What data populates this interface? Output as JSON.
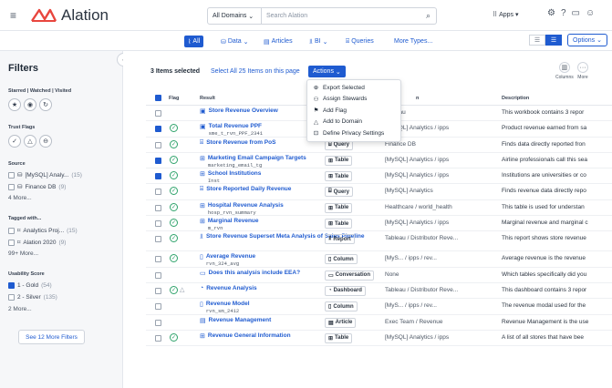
{
  "topbar": {
    "logo_text": "Alation",
    "domain_select": "All Domains",
    "search_placeholder": "Search Alation",
    "apps_label": "Apps"
  },
  "typebar": {
    "tabs": [
      {
        "label": "All",
        "icon": "list-icon",
        "active": true
      },
      {
        "label": "Data",
        "icon": "database-icon",
        "dropdown": true
      },
      {
        "label": "Articles",
        "icon": "article-icon"
      },
      {
        "label": "BI",
        "icon": "bi-icon",
        "dropdown": true
      },
      {
        "label": "Queries",
        "icon": "query-icon"
      },
      {
        "label": "More Types...",
        "icon": ""
      }
    ],
    "options_label": "Options"
  },
  "sidebar": {
    "title": "Filters",
    "starred_label": "Starred | Watched | Visited",
    "trust_label": "Trust Flags",
    "source_label": "Source",
    "source_items": [
      {
        "label": "[MySQL] Analy...",
        "count": "(15)"
      },
      {
        "label": "Finance DB",
        "count": "(9)"
      }
    ],
    "source_more": "4 More...",
    "tagged_label": "Tagged with...",
    "tag_items": [
      {
        "label": "Analytics Proj...",
        "count": "(15)"
      },
      {
        "label": "Alation 2020",
        "count": "(9)"
      }
    ],
    "tag_more": "99+ More...",
    "usability_label": "Usability Score",
    "usability_items": [
      {
        "label": "1 - Gold",
        "count": "(54)",
        "checked": true
      },
      {
        "label": "2 - Silver",
        "count": "(135)",
        "checked": false
      }
    ],
    "usability_more": "2 More...",
    "see_more": "See 12 More Filters"
  },
  "main": {
    "selected_count": "3 Items selected",
    "select_all": "Select All 25 Items on this page",
    "actions_label": "Actions",
    "columns_label": "Columns",
    "more_label": "More",
    "headers": {
      "flag": "Flag",
      "result": "Result",
      "location": "n",
      "description": "Description"
    }
  },
  "actions_menu": [
    {
      "label": "Export Selected",
      "icon": "export-icon"
    },
    {
      "label": "Assign Stewards",
      "icon": "stewards-icon"
    },
    {
      "label": "Add Flag",
      "icon": "flag-icon"
    },
    {
      "label": "Add to Domain",
      "icon": "domain-icon"
    },
    {
      "label": "Define Privacy Settings",
      "icon": "lock-icon"
    }
  ],
  "rows": [
    {
      "checked": false,
      "flag": false,
      "title": "Store Revenue Overview",
      "sub": "",
      "type": "",
      "loc": "Tableau",
      "desc": "This workbook contains 3 repor"
    },
    {
      "checked": true,
      "flag": true,
      "title": "Total Revenue PPF",
      "sub": "sme_t_rvn_PPF_2341",
      "type": "",
      "loc": "[MySQL] Analytics / ipps",
      "desc": "Product revenue earned from sa"
    },
    {
      "checked": false,
      "flag": true,
      "title": "Store Revenue from PoS",
      "sub": "",
      "type": "Query",
      "loc": "Finance DB",
      "desc": "Finds data directly reported fron"
    },
    {
      "checked": true,
      "flag": true,
      "title": "Marketing Email Campaign Targets",
      "sub": "marketing_email_tg",
      "type": "Table",
      "loc": "[MySQL] Analytics / ipps",
      "desc": "Airline professionals call this sea"
    },
    {
      "checked": true,
      "flag": true,
      "title": "School Institutions",
      "sub": "Inst",
      "type": "Table",
      "loc": "[MySQL] Analytics / ipps",
      "desc": "Institutions are universities or co"
    },
    {
      "checked": false,
      "flag": true,
      "title": "Store Reported Daily Revenue",
      "sub": "",
      "type": "Query",
      "loc": "[MySQL] Analytics",
      "desc": "Finds revenue data directly repo"
    },
    {
      "checked": false,
      "flag": true,
      "title": "Hospital Revenue Analysis",
      "sub": "hosp_rvn_summary",
      "type": "Table",
      "loc": "Healthcare / world_health",
      "desc": "This table is used for understan"
    },
    {
      "checked": false,
      "flag": true,
      "title": "Marginal Revenue",
      "sub": "m_rvn",
      "type": "Table",
      "loc": "[MySQL] Analytics / ipps",
      "desc": "Marginal revenue and marginal c"
    },
    {
      "checked": false,
      "flag": true,
      "title": "Store Revenue Superset Meta Analysis of Sales Pipeline",
      "sub": "",
      "type": "Report",
      "loc": "Tableau / Distributor Reve...",
      "desc": "This report shows store revenue"
    },
    {
      "checked": false,
      "flag": true,
      "title": "Average Revenue",
      "sub": "rvn_324_avg",
      "type": "Column",
      "loc": "[MyS... / ipps / rev...",
      "desc": "Average revenue is the revenue"
    },
    {
      "checked": false,
      "flag": false,
      "title": "Does this analysis include EEA?",
      "sub": "",
      "type": "Conversation",
      "loc": "None",
      "desc": "Which tables specifically did you"
    },
    {
      "checked": false,
      "flag": true,
      "title": "Revenue Analysis",
      "sub": "",
      "type": "Dashboard",
      "loc": "Tableau / Distributor Reve...",
      "desc": "This dashboard contains 3 repor"
    },
    {
      "checked": false,
      "flag": false,
      "title": "Revenue Model",
      "sub": "rvn_sm_2412",
      "type": "Column",
      "loc": "[MyS... / ipps / rev...",
      "desc": "The revenue modal used for the"
    },
    {
      "checked": false,
      "flag": false,
      "title": "Revenue Management",
      "sub": "",
      "type": "Article",
      "loc": "Exec Team / Revenue",
      "desc": "Revenue Management is the use"
    },
    {
      "checked": false,
      "flag": true,
      "title": "Revenue General Information",
      "sub": "",
      "type": "Table",
      "loc": "[MySQL] Analytics / ipps",
      "desc": "A list of all stores that have bee"
    }
  ]
}
